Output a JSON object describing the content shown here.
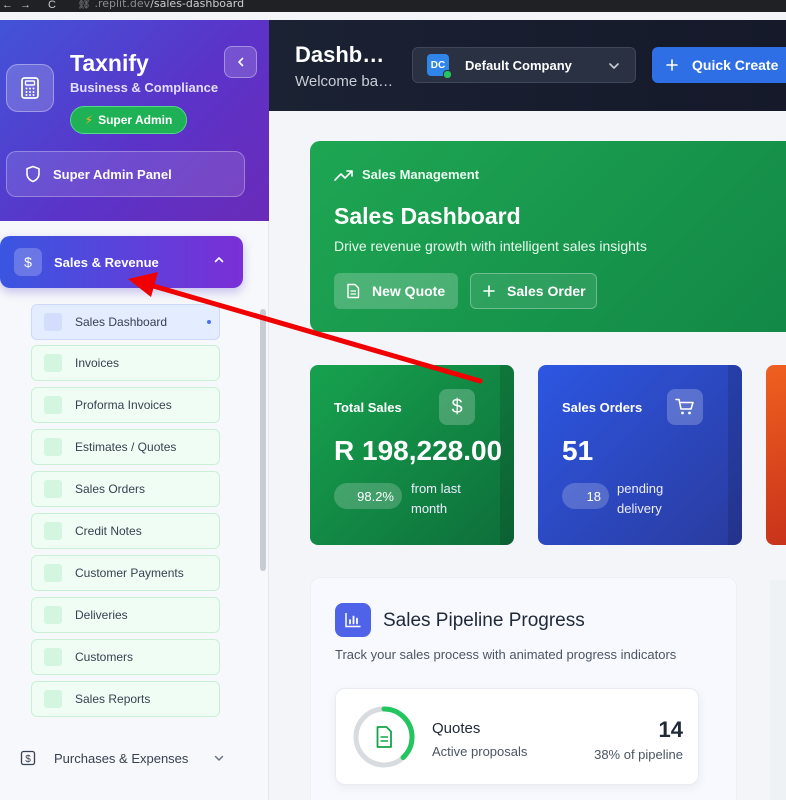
{
  "browser": {
    "url_domain": ".replit.dev",
    "url_path": "/sales-dashboard",
    "nav_back": "←",
    "nav_forward": "→",
    "nav_reload": "C"
  },
  "sidebar": {
    "brand": "Taxnify",
    "subtitle": "Business & Compliance",
    "role_badge": "Super Admin",
    "admin_panel": "Super Admin Panel",
    "active_section": "Sales & Revenue",
    "items": [
      "Sales Dashboard",
      "Invoices",
      "Proforma Invoices",
      "Estimates / Quotes",
      "Sales Orders",
      "Credit Notes",
      "Customer Payments",
      "Deliveries",
      "Customers",
      "Sales Reports"
    ],
    "collapsed_section": "Purchases & Expenses"
  },
  "header": {
    "title": "Dashb…",
    "welcome": "Welcome ba…",
    "company_initials": "DC",
    "company": "Default Company",
    "quick_create": "Quick Create"
  },
  "hero": {
    "eyebrow": "Sales Management",
    "title": "Sales Dashboard",
    "description": "Drive revenue growth with intelligent sales insights",
    "btn_quote": "New Quote",
    "btn_order": "Sales Order"
  },
  "stats": {
    "total_sales": {
      "label": "Total Sales",
      "value": "R 198,228.00",
      "change": "98.2%",
      "note_line1": "from last",
      "note_line2": "month"
    },
    "sales_orders": {
      "label": "Sales Orders",
      "value": "51",
      "pending": "18",
      "note_line1": "pending",
      "note_line2": "delivery"
    }
  },
  "pipeline": {
    "title": "Sales Pipeline Progress",
    "description": "Track your sales process with animated progress indicators",
    "quotes": {
      "name": "Quotes",
      "sub": "Active proposals",
      "count": "14",
      "pct": "38% of pipeline",
      "ring_fraction": 0.38
    }
  },
  "colors": {
    "green": "#1ea653",
    "blue": "#2d56e2",
    "purple": "#5b33c9",
    "arrow": "#f00000"
  }
}
